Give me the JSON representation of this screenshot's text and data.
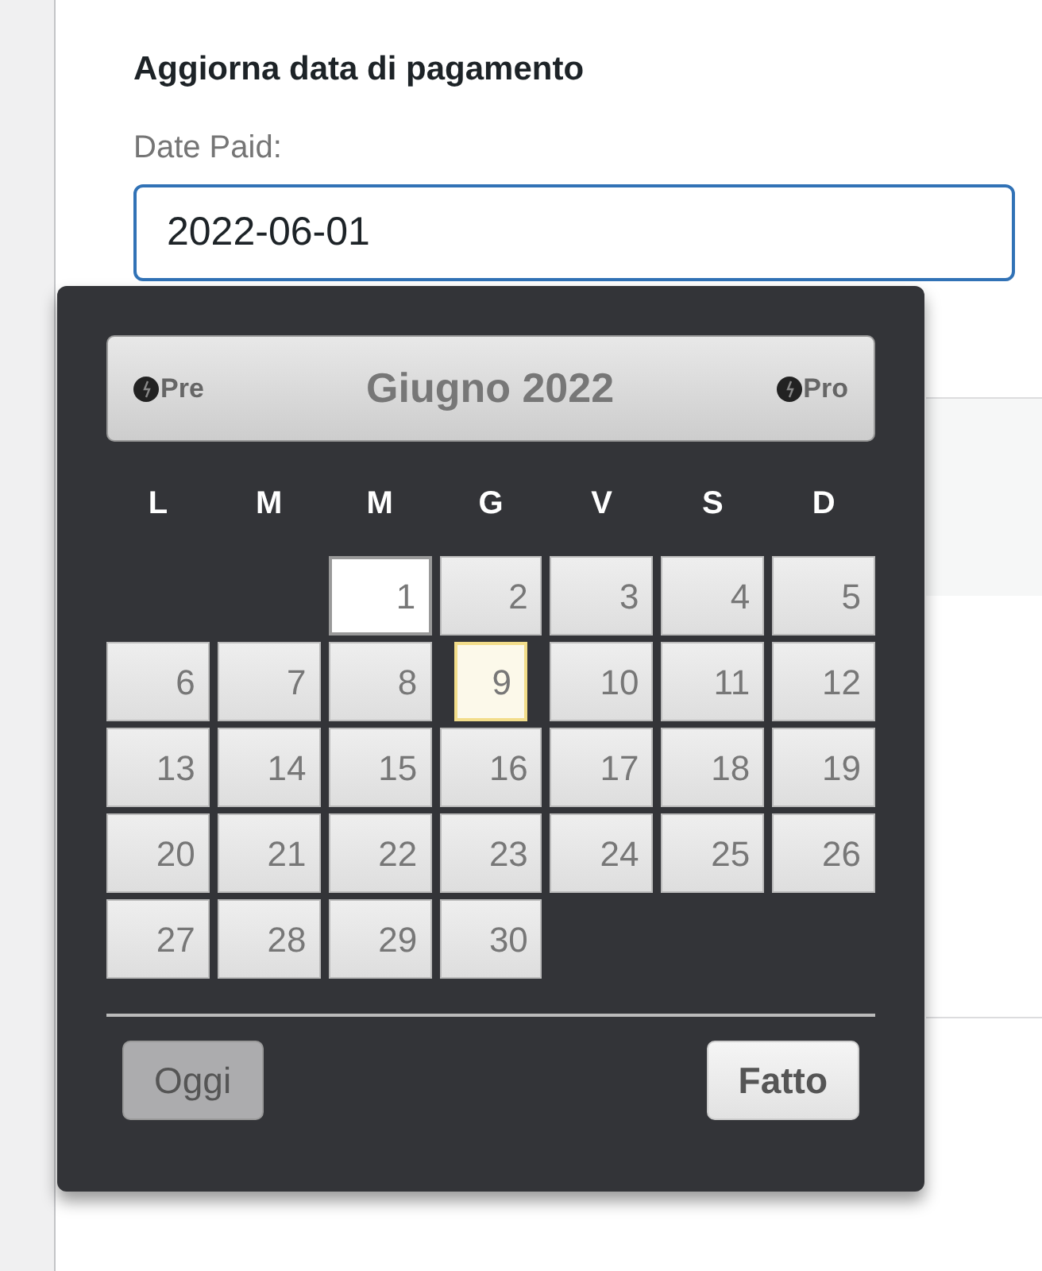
{
  "heading": "Aggiorna data di pagamento",
  "field": {
    "label": "Date Paid:",
    "value": "2022-06-01",
    "focused": true
  },
  "datepicker": {
    "prev": "Pre",
    "next": "Pro",
    "title": "Giugno 2022",
    "weekdays": [
      "L",
      "M",
      "M",
      "G",
      "V",
      "S",
      "D"
    ],
    "weeks": [
      [
        {
          "kind": "blank"
        },
        {
          "kind": "blank"
        },
        {
          "day": "1",
          "selected": true,
          "today": false
        },
        {
          "day": "2",
          "selected": false,
          "today": false
        },
        {
          "day": "3",
          "selected": false,
          "today": false
        },
        {
          "day": "4",
          "selected": false,
          "today": false
        },
        {
          "day": "5",
          "selected": false,
          "today": false
        }
      ],
      [
        {
          "day": "6",
          "selected": false,
          "today": false
        },
        {
          "day": "7",
          "selected": false,
          "today": false
        },
        {
          "day": "8",
          "selected": false,
          "today": false
        },
        {
          "day": "9",
          "selected": false,
          "today": true
        },
        {
          "day": "10",
          "selected": false,
          "today": false
        },
        {
          "day": "11",
          "selected": false,
          "today": false
        },
        {
          "day": "12",
          "selected": false,
          "today": false
        }
      ],
      [
        {
          "day": "13",
          "selected": false,
          "today": false
        },
        {
          "day": "14",
          "selected": false,
          "today": false
        },
        {
          "day": "15",
          "selected": false,
          "today": false
        },
        {
          "day": "16",
          "selected": false,
          "today": false
        },
        {
          "day": "17",
          "selected": false,
          "today": false
        },
        {
          "day": "18",
          "selected": false,
          "today": false
        },
        {
          "day": "19",
          "selected": false,
          "today": false
        }
      ],
      [
        {
          "day": "20",
          "selected": false,
          "today": false
        },
        {
          "day": "21",
          "selected": false,
          "today": false
        },
        {
          "day": "22",
          "selected": false,
          "today": false
        },
        {
          "day": "23",
          "selected": false,
          "today": false
        },
        {
          "day": "24",
          "selected": false,
          "today": false
        },
        {
          "day": "25",
          "selected": false,
          "today": false
        },
        {
          "day": "26",
          "selected": false,
          "today": false
        }
      ],
      [
        {
          "day": "27",
          "selected": false,
          "today": false
        },
        {
          "day": "28",
          "selected": false,
          "today": false
        },
        {
          "day": "29",
          "selected": false,
          "today": false
        },
        {
          "day": "30",
          "selected": false,
          "today": false
        },
        {
          "kind": "blank"
        },
        {
          "kind": "blank"
        },
        {
          "kind": "blank"
        }
      ]
    ],
    "buttons": [
      {
        "label": "Oggi",
        "disabled": true
      },
      {
        "label": "Fatto",
        "disabled": false
      }
    ]
  }
}
